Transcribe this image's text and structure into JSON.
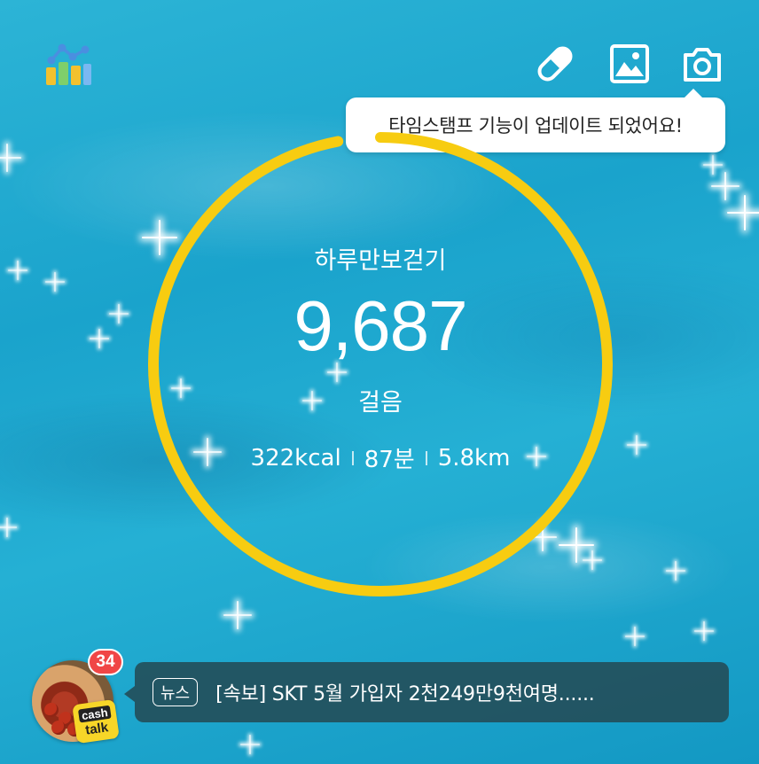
{
  "header": {
    "icons": [
      "stats-icon",
      "pill-icon",
      "gallery-icon",
      "camera-icon"
    ]
  },
  "tooltip": {
    "text": "타임스탬프 기능이 업데이트 되었어요!"
  },
  "pedometer": {
    "title": "하루만보걷기",
    "steps": "9,687",
    "unit": "걸음",
    "calories": "322kcal",
    "minutes": "87분",
    "distance": "5.8km",
    "progress": 0.97
  },
  "news": {
    "badge_count": "34",
    "tag": "뉴스",
    "headline": "[속보] SKT 5월 가입자 2천249만9천여명......",
    "cashtalk_line1": "cash",
    "cashtalk_line2": "talk"
  },
  "colors": {
    "ring": "#f7cc11",
    "water": "#1aa3cc",
    "badge": "#f04646"
  }
}
